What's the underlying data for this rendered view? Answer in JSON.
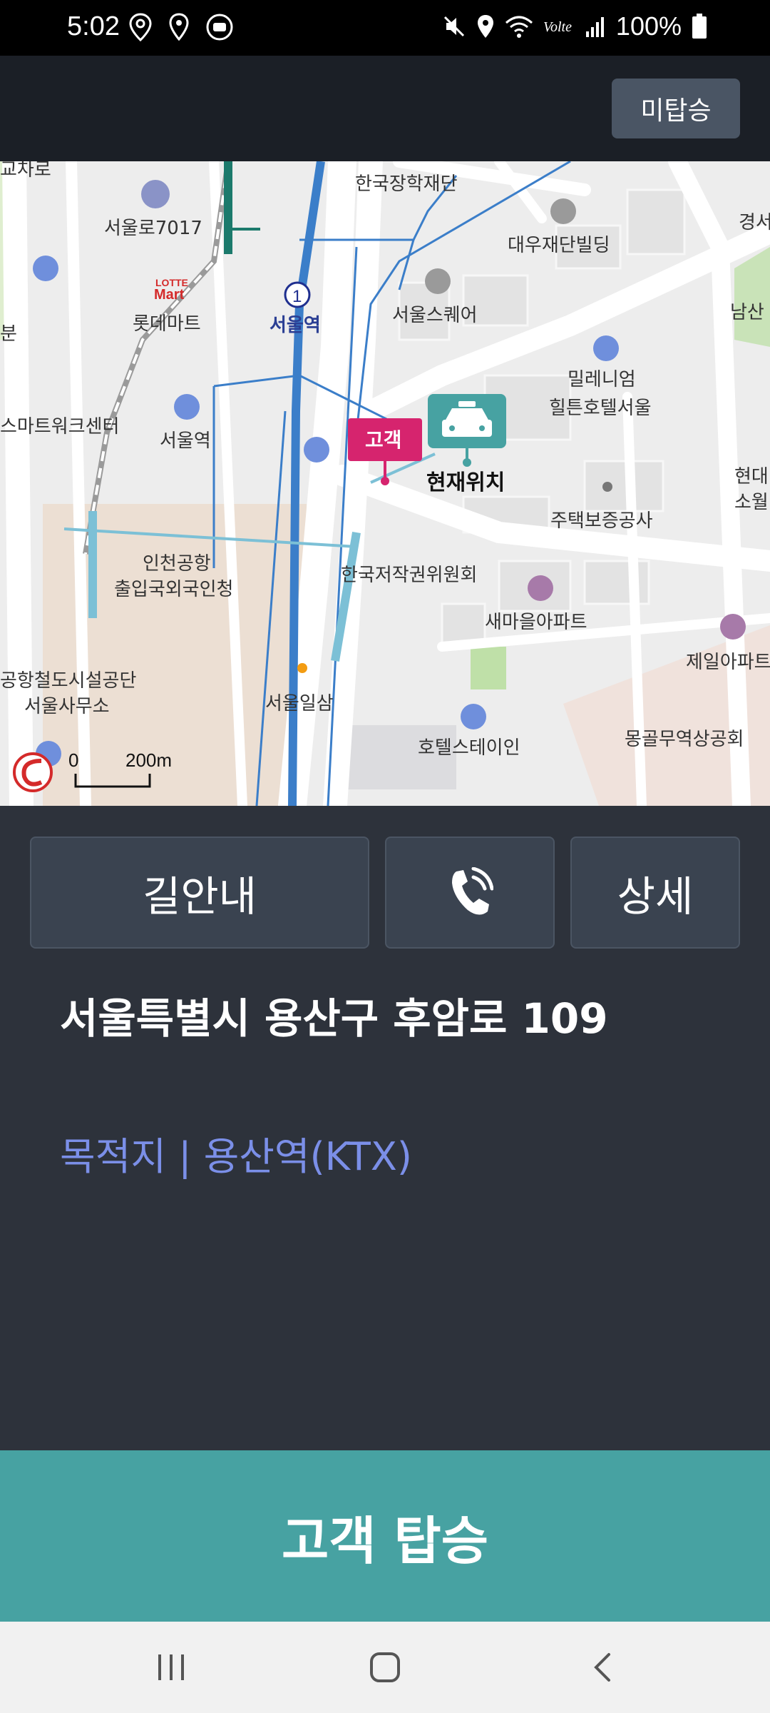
{
  "status": {
    "time": "5:02",
    "battery": "100%"
  },
  "top_bar": {
    "not_boarded_label": "미탑승"
  },
  "map": {
    "labels": {
      "seoul_station": "서울역",
      "seoullo": "서울로7017",
      "lotte_mart": "롯데마트",
      "lotte_logo_top": "LOTTE",
      "lotte_logo_bottom": "Mart",
      "korea_scholarship": "한국장학재단",
      "daewoo": "대우재단빌딩",
      "seoul_square": "서울스퀘어",
      "millennium_1": "밀레니엄",
      "millennium_2": "힐튼호텔서울",
      "smartwork": "스마트워크센터",
      "seoul_station_bus": "서울역",
      "incheon_1": "인천공항",
      "incheon_2": "출입국외국인청",
      "copyright": "한국저작권위원회",
      "saemaeul": "새마을아파트",
      "housing": "주택보증공사",
      "jeil": "제일아파트",
      "rail_facility_1": "공항철도시설공단",
      "rail_facility_2": "서울사무소",
      "seoul_ilsam": "서울일삼",
      "hotel_stay": "호텔스테이인",
      "mongol": "몽골무역상공회",
      "top_left_partial": "교차로",
      "namsan_partial": "남산",
      "right_partial_1": "경서",
      "right_partial_2": "현대",
      "right_partial_3": "소월",
      "left_partial": "분",
      "current_location": "현재위치",
      "customer_marker": "고객",
      "line_number": "1",
      "scale_zero": "0",
      "scale_distance": "200m"
    }
  },
  "actions": {
    "navigate_label": "길안내",
    "call_icon": "phone-ringing-icon",
    "detail_label": "상세"
  },
  "trip": {
    "address": "서울특별시 용산구 후암로 109",
    "destination": "목적지 | 용산역(KTX)"
  },
  "board_button_label": "고객 탑승",
  "colors": {
    "accent_teal": "#47a2a2",
    "customer_pink": "#d6246e",
    "destination_blue": "#7b8fe8"
  }
}
